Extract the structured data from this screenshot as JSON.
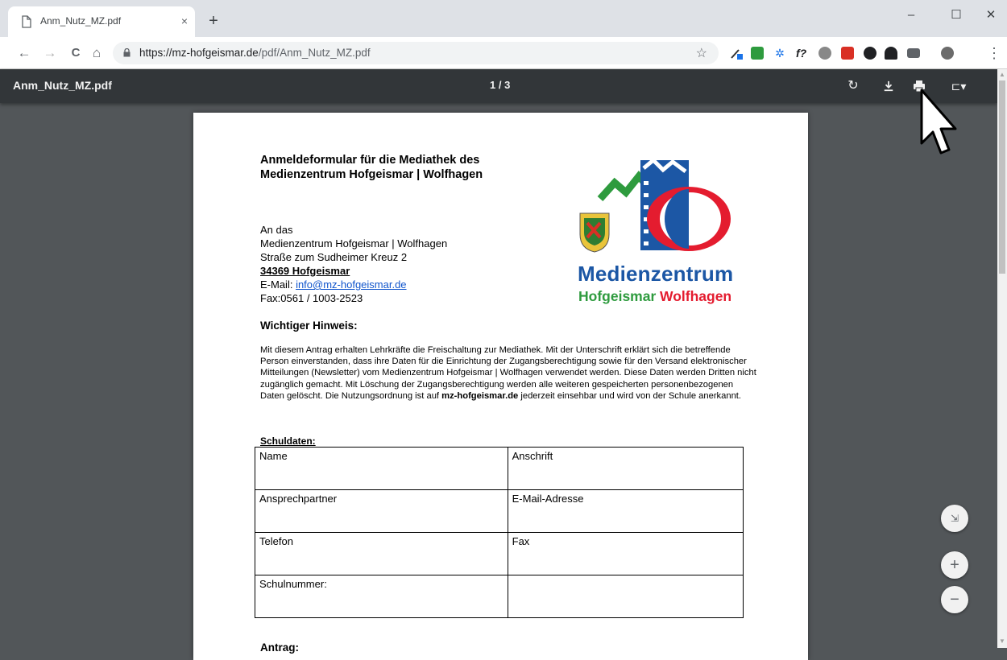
{
  "browser": {
    "tab_title": "Anm_Nutz_MZ.pdf",
    "tab_close": "×",
    "new_tab": "+",
    "window": {
      "minimize": "–",
      "maximize": "☐",
      "close": "✕"
    },
    "nav": {
      "back": "←",
      "forward": "→",
      "reload": "C",
      "home": "⌂"
    },
    "url_host": "https://mz-hofgeismar.de",
    "url_path": "/pdf/Anm_Nutz_MZ.pdf",
    "star": "☆",
    "menu": "⋮"
  },
  "pdf_viewer": {
    "file_name": "Anm_Nutz_MZ.pdf",
    "page_indicator": "1 / 3",
    "rotate": "↻",
    "download": "⭳",
    "print": "⎙",
    "bookmark": "⊏▾",
    "fit_page": "⇲",
    "zoom_in": "+",
    "zoom_out": "−"
  },
  "document": {
    "heading_line1": "Anmeldeformular für die Mediathek des",
    "heading_line2": "Medienzentrum Hofgeismar | Wolfhagen",
    "address": {
      "line1": "An das",
      "line2": "Medienzentrum Hofgeismar | Wolfhagen",
      "line3": "Straße zum Sudheimer Kreuz 2",
      "line4": "34369 Hofgeismar",
      "email_label": "E-Mail: ",
      "email": "info@mz-hofgeismar.de",
      "fax": "Fax:0561 / 1003-2523"
    },
    "logo": {
      "word1": "Medienzentrum",
      "word2": "Hofgeismar",
      "word3": "Wolfhagen"
    },
    "hint_title": "Wichtiger Hinweis:",
    "hint_text_1": "Mit diesem Antrag erhalten Lehrkräfte die Freischaltung zur Mediathek. Mit der Unterschrift erklärt sich die betreffende Person einverstanden, dass ihre Daten für die Einrichtung der Zugangsberechtigung sowie für den Versand elektronischer Mitteilungen (Newsletter) vom Medienzentrum Hofgeismar | Wolfhagen verwendet werden. Diese Daten werden Dritten nicht zugänglich gemacht. Mit Löschung der Zugangsberechtigung werden alle weiteren gespeicherten personenbezogenen Daten gelöscht. Die Nutzungsordnung ist auf ",
    "hint_text_bold": "mz-hofgeismar.de",
    "hint_text_2": " jederzeit einsehbar und wird von der Schule anerkannt.",
    "schuldaten_title": "Schuldaten:",
    "table": [
      [
        "Name",
        "Anschrift"
      ],
      [
        "Ansprechpartner",
        "E-Mail-Adresse"
      ],
      [
        "Telefon",
        "Fax"
      ],
      [
        "Schulnummer:",
        ""
      ]
    ],
    "antrag_title": "Antrag:"
  }
}
